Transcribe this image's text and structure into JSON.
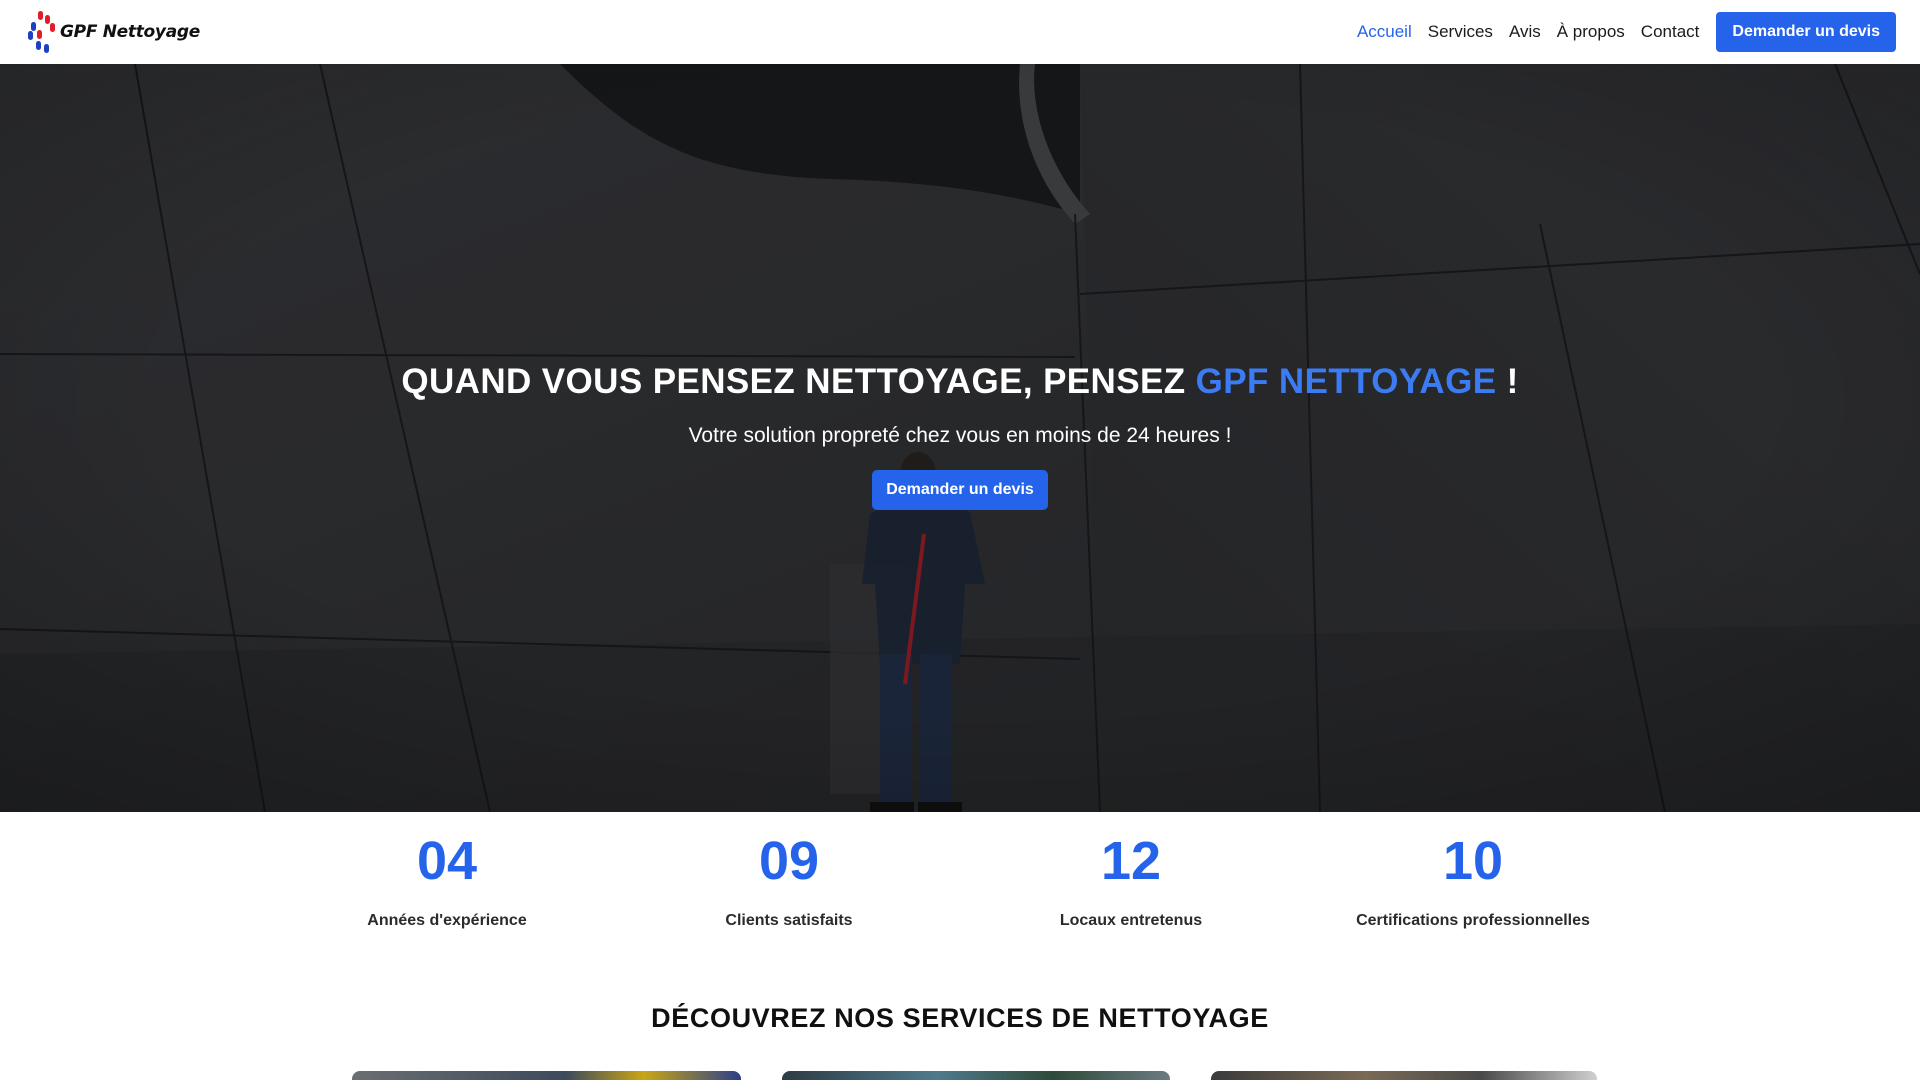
{
  "brand": {
    "name": "GPF Nettoyage",
    "primary": "#2563eb",
    "accent": "#3b7cf5",
    "logo_red": "#e11d2a"
  },
  "nav": {
    "items": [
      {
        "label": "Accueil",
        "active": true
      },
      {
        "label": "Services",
        "active": false
      },
      {
        "label": "Avis",
        "active": false
      },
      {
        "label": "À propos",
        "active": false
      },
      {
        "label": "Contact",
        "active": false
      }
    ],
    "cta": "Demander un devis"
  },
  "hero": {
    "title_prefix": "QUAND VOUS PENSEZ NETTOYAGE, PENSEZ ",
    "title_accent": "GPF NETTOYAGE",
    "title_suffix": " !",
    "subtitle": "Votre solution propreté chez vous en moins de 24 heures !",
    "button": "Demander un devis"
  },
  "stats": [
    {
      "value": "04",
      "label": "Années d'expérience"
    },
    {
      "value": "09",
      "label": "Clients satisfaits"
    },
    {
      "value": "12",
      "label": "Locaux entretenus"
    },
    {
      "value": "10",
      "label": "Certifications professionnelles"
    }
  ],
  "services": {
    "title": "DÉCOUVREZ NOS SERVICES DE NETTOYAGE"
  }
}
